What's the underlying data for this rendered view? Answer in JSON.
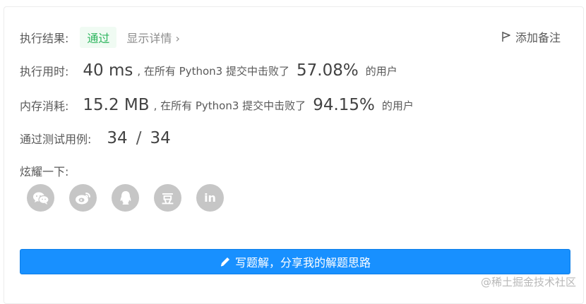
{
  "result": {
    "label": "执行结果:",
    "status": "通过",
    "detail_link": "显示详情 ›",
    "note_button": "添加备注"
  },
  "runtime": {
    "label": "执行用时:",
    "value": "40 ms",
    "text": ", 在所有 Python3 提交中击败了",
    "percent": "57.08%",
    "suffix": "的用户"
  },
  "memory": {
    "label": "内存消耗:",
    "value": "15.2 MB",
    "text": ", 在所有 Python3 提交中击败了",
    "percent": "94.15%",
    "suffix": "的用户"
  },
  "tests": {
    "label": "通过测试用例:",
    "passed": "34",
    "separator": "/",
    "total": "34"
  },
  "share": {
    "label": "炫耀一下:",
    "icons": [
      "wechat-icon",
      "weibo-icon",
      "qq-icon",
      "douban-icon",
      "linkedin-icon"
    ],
    "douban_glyph": "豆",
    "linkedin_glyph": "in"
  },
  "solution_button": "写题解，分享我的解题思路",
  "watermark": "@稀土掘金技术社区",
  "colors": {
    "pass_green": "#2db55d",
    "primary_blue": "#1890ff",
    "icon_gray": "#c6c6c6"
  }
}
